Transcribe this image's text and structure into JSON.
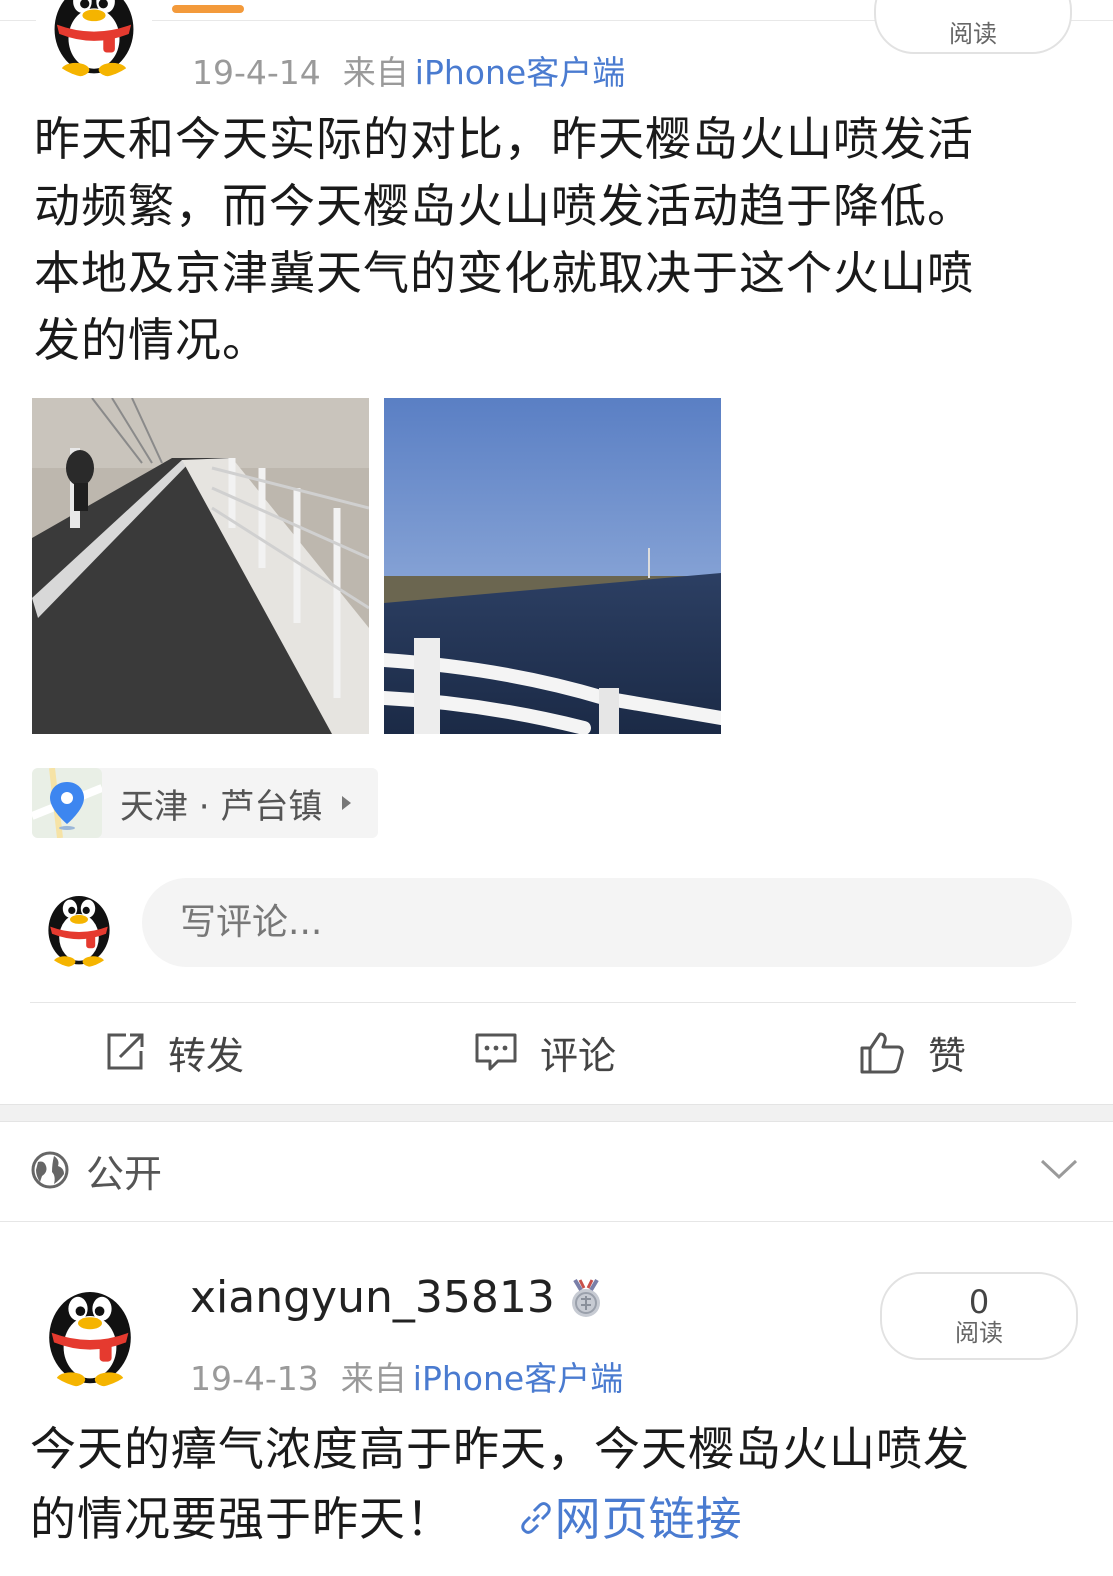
{
  "post1": {
    "time": "19-4-14",
    "source_prefix": "来自",
    "source": "iPhone客户端",
    "read_label": "阅读",
    "text_lines": [
      "昨天和今天实际的对比，昨天樱岛火山喷发活",
      "动频繁，而今天樱岛火山喷发活动趋于降低。",
      "本地及京津冀天气的变化就取决于这个火山喷",
      "发的情况。"
    ],
    "location": "天津 · 芦台镇"
  },
  "comment_box": {
    "placeholder": "写评论..."
  },
  "actions": {
    "repost": "转发",
    "comment": "评论",
    "like": "赞"
  },
  "privacy": {
    "label": "公开"
  },
  "post2": {
    "username": "xiangyun_35813",
    "read_count": "0",
    "read_label": "阅读",
    "time": "19-4-13",
    "source_prefix": "来自",
    "source": "iPhone客户端",
    "text_line1": "今天的瘴气浓度高于昨天，今天樱岛火山喷发",
    "text_line2": "的情况要强于昨天！",
    "link_label": "网页链接"
  },
  "colors": {
    "accent_blue": "#4a7bd0",
    "orange": "#f39a3b",
    "meta_gray": "#9a9a9a"
  }
}
